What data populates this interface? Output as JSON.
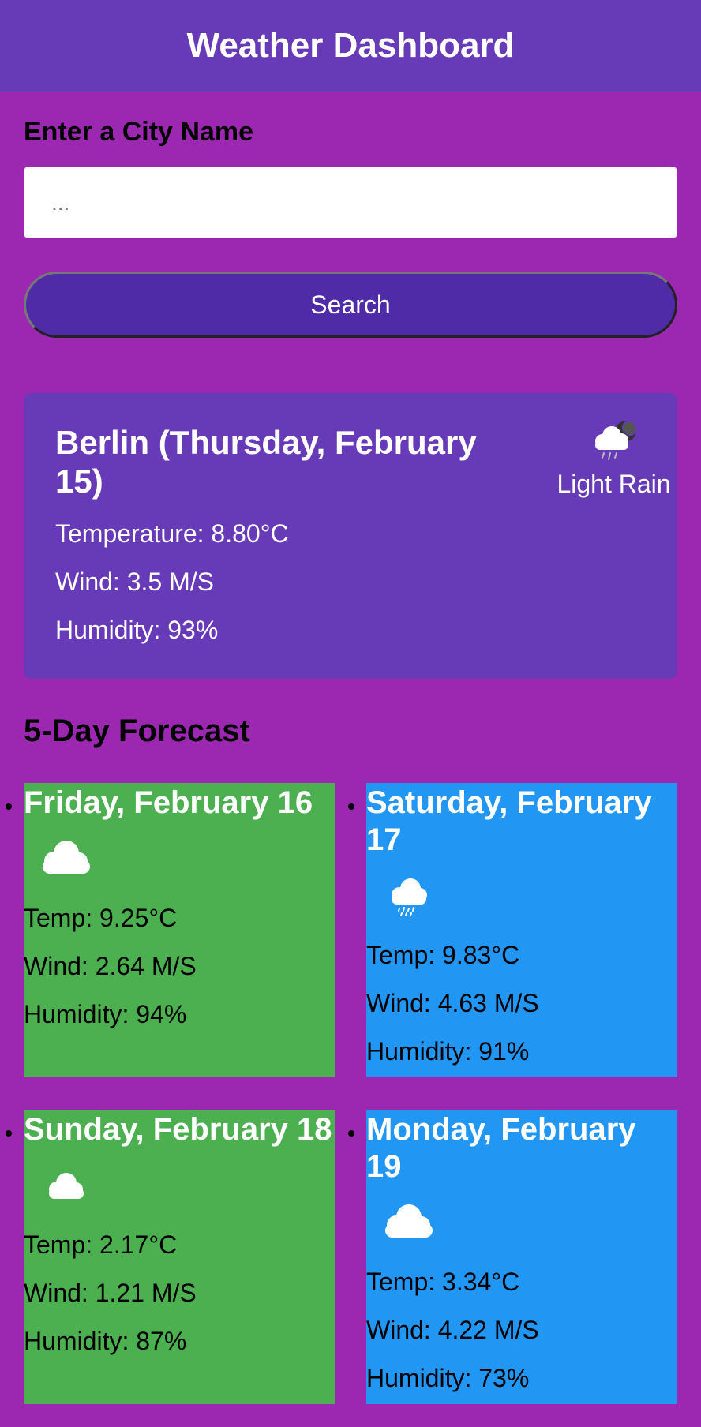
{
  "header": {
    "title": "Weather Dashboard"
  },
  "search": {
    "label": "Enter a City Name",
    "placeholder": "...",
    "value": "",
    "button_label": "Search"
  },
  "current": {
    "city_date": "Berlin (Thursday, February 15)",
    "temperature": "Temperature: 8.80°C",
    "wind": "Wind: 3.5 M/S",
    "humidity": "Humidity: 93%",
    "description": "Light Rain",
    "icon": "rain-cloud-moon-icon"
  },
  "forecast": {
    "title": "5-Day Forecast",
    "days": [
      {
        "date": "Friday, February 16",
        "temp": "Temp: 9.25°C",
        "wind": "Wind: 2.64 M/S",
        "humidity": "Humidity: 94%",
        "icon": "cloud-icon",
        "color": "#4caf50"
      },
      {
        "date": "Saturday, February 17",
        "temp": "Temp: 9.83°C",
        "wind": "Wind: 4.63 M/S",
        "humidity": "Humidity: 91%",
        "icon": "rain-cloud-icon",
        "color": "#2196f3"
      },
      {
        "date": "Sunday, February 18",
        "temp": "Temp: 2.17°C",
        "wind": "Wind: 1.21 M/S",
        "humidity": "Humidity: 87%",
        "icon": "cloud-icon",
        "color": "#4caf50"
      },
      {
        "date": "Monday, February 19",
        "temp": "Temp: 3.34°C",
        "wind": "Wind: 4.22 M/S",
        "humidity": "Humidity: 73%",
        "icon": "cloud-icon",
        "color": "#2196f3"
      }
    ]
  },
  "colors": {
    "page_background": "#9c27b0",
    "header_background": "#673ab7",
    "button_background": "#4f2ba8",
    "current_card_background": "#673ab7",
    "forecast_green": "#4caf50",
    "forecast_blue": "#2196f3"
  }
}
